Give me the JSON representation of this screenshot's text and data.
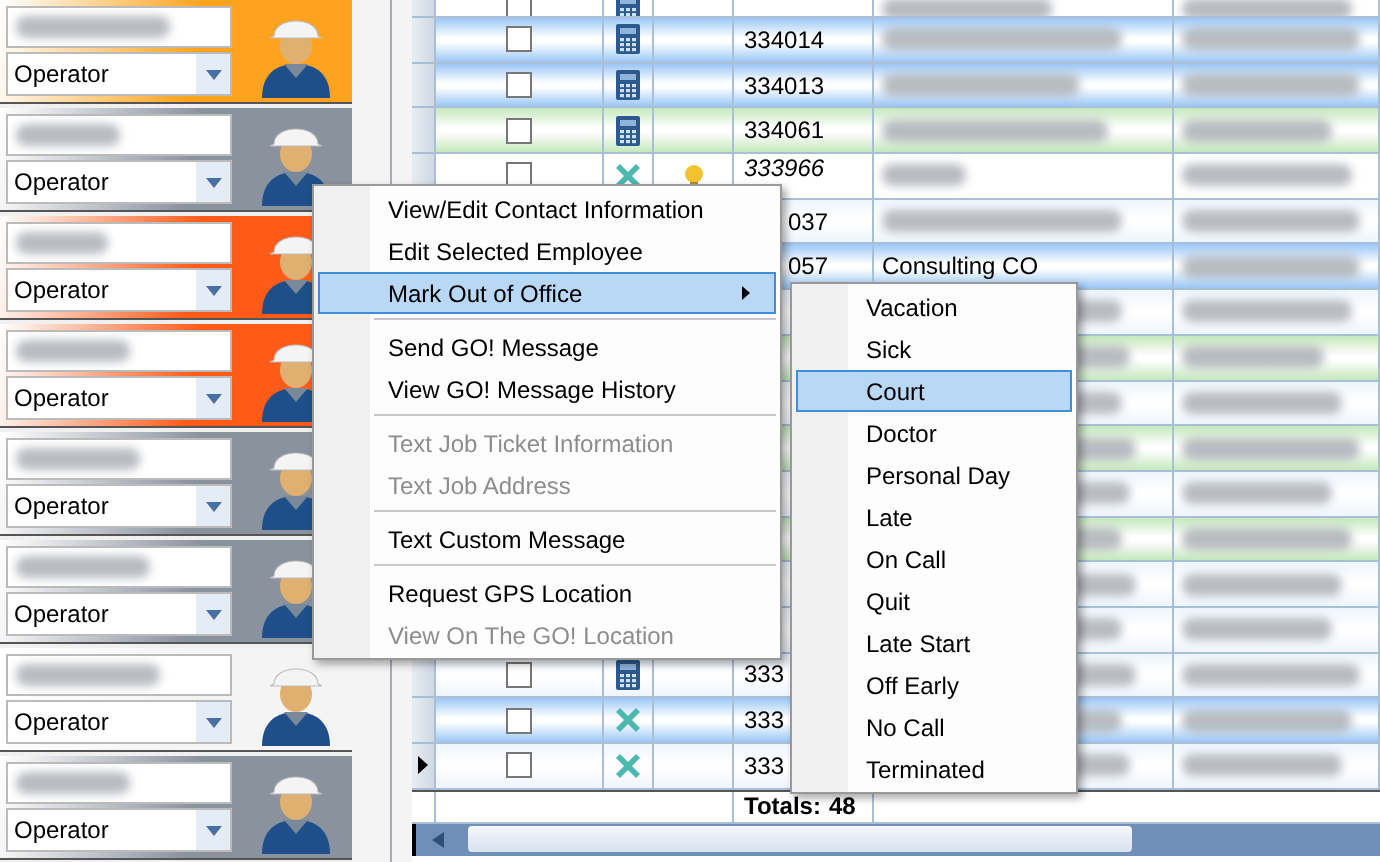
{
  "employees": [
    {
      "role": "Operator",
      "color": "#ffa31f"
    },
    {
      "role": "Operator",
      "color": "#8a929e"
    },
    {
      "role": "Operator",
      "color": "#ff5a18"
    },
    {
      "role": "Operator",
      "color": "#ff5a18"
    },
    {
      "role": "Operator",
      "color": "#8a929e"
    },
    {
      "role": "Operator",
      "color": "#8a929e"
    },
    {
      "role": "Operator",
      "color": "#f4f4f4"
    },
    {
      "role": "Operator",
      "color": "#8a929e"
    }
  ],
  "grid": {
    "rows": [
      {
        "color": "#ffffff",
        "checked": false,
        "kind": "calculator",
        "bulb": false,
        "current": false
      },
      {
        "color": "#9cc7f5",
        "checked": false,
        "kind": "calculator",
        "bulb": false,
        "current": false,
        "number": "334014"
      },
      {
        "color": "#9cc7f5",
        "checked": false,
        "kind": "calculator",
        "bulb": false,
        "current": false,
        "number": "334013"
      },
      {
        "color": "#c5e8bd",
        "checked": false,
        "kind": "calculator",
        "bulb": false,
        "current": false,
        "number": "334061"
      },
      {
        "color": "#ffffff",
        "checked": false,
        "kind": "cross",
        "bulb": true,
        "current": false,
        "number": "333966",
        "italic": true
      },
      {
        "color": "#eef5fd",
        "kind": "plain",
        "number": "037"
      },
      {
        "color": "#9cc7f5",
        "kind": "plain",
        "number": "057",
        "company": "Consulting CO"
      },
      {
        "color": "#eef5fd",
        "kind": "plain"
      },
      {
        "color": "#c5e8bd",
        "kind": "plain"
      },
      {
        "color": "#eef5fd",
        "kind": "plain"
      },
      {
        "color": "#c5e8bd",
        "kind": "plain"
      },
      {
        "color": "#eef5fd",
        "kind": "plain"
      },
      {
        "color": "#c5e8bd",
        "kind": "plain"
      },
      {
        "color": "#eef5fd",
        "kind": "plain"
      },
      {
        "color": "#eef5fd",
        "kind": "plain"
      },
      {
        "color": "#eef5fd",
        "checked": false,
        "kind": "calculator",
        "bulb": false,
        "current": false,
        "number": "333"
      },
      {
        "color": "#9cc7f5",
        "checked": false,
        "kind": "cross",
        "bulb": false,
        "current": false,
        "number": "333"
      },
      {
        "color": "#eef5fd",
        "checked": false,
        "kind": "cross",
        "bulb": false,
        "current": true,
        "number": "333"
      }
    ],
    "totals_label": "Totals:",
    "total": "48"
  },
  "context_menu": {
    "items": [
      {
        "kind": "item",
        "label": "View/Edit Contact Information",
        "disabled": false,
        "selected": false,
        "submenu": false
      },
      {
        "kind": "item",
        "label": "Edit Selected Employee",
        "disabled": false,
        "selected": false,
        "submenu": false
      },
      {
        "kind": "item",
        "label": "Mark Out of Office",
        "disabled": false,
        "selected": true,
        "submenu": true
      },
      {
        "kind": "separator"
      },
      {
        "kind": "item",
        "label": "Send GO! Message",
        "disabled": false,
        "selected": false,
        "submenu": false
      },
      {
        "kind": "item",
        "label": "View GO! Message History",
        "disabled": false,
        "selected": false,
        "submenu": false
      },
      {
        "kind": "separator"
      },
      {
        "kind": "item",
        "label": "Text Job Ticket Information",
        "disabled": true,
        "selected": false,
        "submenu": false
      },
      {
        "kind": "item",
        "label": "Text Job Address",
        "disabled": true,
        "selected": false,
        "submenu": false
      },
      {
        "kind": "separator"
      },
      {
        "kind": "item",
        "label": "Text Custom Message",
        "disabled": false,
        "selected": false,
        "submenu": false
      },
      {
        "kind": "separator"
      },
      {
        "kind": "item",
        "label": "Request GPS Location",
        "disabled": false,
        "selected": false,
        "submenu": false
      },
      {
        "kind": "item",
        "label": "View On The GO! Location",
        "disabled": true,
        "selected": false,
        "submenu": false
      }
    ]
  },
  "submenu": {
    "items": [
      {
        "label": "Vacation",
        "selected": false
      },
      {
        "label": "Sick",
        "selected": false
      },
      {
        "label": "Court",
        "selected": true
      },
      {
        "label": "Doctor",
        "selected": false
      },
      {
        "label": "Personal Day",
        "selected": false
      },
      {
        "label": "Late",
        "selected": false
      },
      {
        "label": "On Call",
        "selected": false
      },
      {
        "label": "Quit",
        "selected": false
      },
      {
        "label": "Late Start",
        "selected": false
      },
      {
        "label": "Off Early",
        "selected": false
      },
      {
        "label": "No Call",
        "selected": false
      },
      {
        "label": "Terminated",
        "selected": false
      }
    ]
  }
}
